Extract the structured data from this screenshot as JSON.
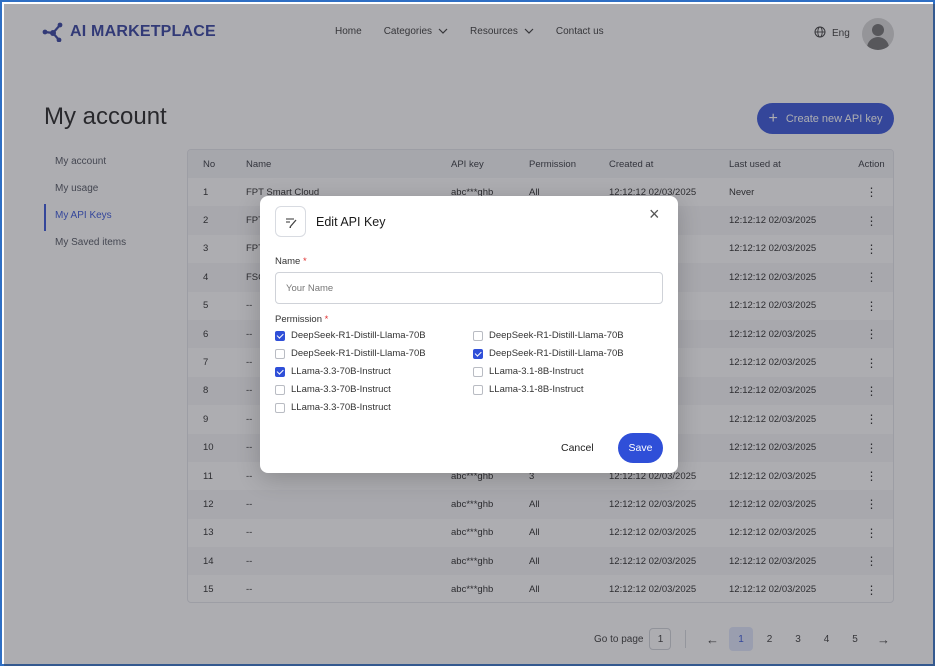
{
  "header": {
    "logo_text": "AI MARKETPLACE",
    "nav": [
      {
        "label": "Home",
        "dropdown": false
      },
      {
        "label": "Categories",
        "dropdown": true
      },
      {
        "label": "Resources",
        "dropdown": true
      },
      {
        "label": "Contact us",
        "dropdown": false
      }
    ],
    "language": "Eng"
  },
  "page": {
    "title": "My account",
    "create_button": "Create new API key"
  },
  "sidebar": {
    "items": [
      {
        "label": "My account",
        "active": false
      },
      {
        "label": "My usage",
        "active": false
      },
      {
        "label": "My API Keys",
        "active": true
      },
      {
        "label": "My Saved items",
        "active": false
      }
    ]
  },
  "table": {
    "columns": [
      "No",
      "Name",
      "API key",
      "Permission",
      "Created at",
      "Last used at",
      "Action"
    ],
    "rows": [
      {
        "no": "1",
        "name": "FPT Smart Cloud",
        "key": "abc***ghb",
        "perm": "All",
        "created": "12:12:12 02/03/2025",
        "last": "Never"
      },
      {
        "no": "2",
        "name": "FPT",
        "key": "",
        "perm": "",
        "created": "",
        "last": "12:12:12 02/03/2025"
      },
      {
        "no": "3",
        "name": "FPT",
        "key": "",
        "perm": "",
        "created": "",
        "last": "12:12:12 02/03/2025"
      },
      {
        "no": "4",
        "name": "FSC",
        "key": "",
        "perm": "",
        "created": "",
        "last": "12:12:12 02/03/2025"
      },
      {
        "no": "5",
        "name": "--",
        "key": "",
        "perm": "",
        "created": "",
        "last": "12:12:12 02/03/2025"
      },
      {
        "no": "6",
        "name": "--",
        "key": "",
        "perm": "",
        "created": "",
        "last": "12:12:12 02/03/2025"
      },
      {
        "no": "7",
        "name": "--",
        "key": "",
        "perm": "",
        "created": "",
        "last": "12:12:12 02/03/2025"
      },
      {
        "no": "8",
        "name": "--",
        "key": "",
        "perm": "",
        "created": "",
        "last": "12:12:12 02/03/2025"
      },
      {
        "no": "9",
        "name": "--",
        "key": "",
        "perm": "",
        "created": "",
        "last": "12:12:12 02/03/2025"
      },
      {
        "no": "10",
        "name": "--",
        "key": "",
        "perm": "",
        "created": "",
        "last": "12:12:12 02/03/2025"
      },
      {
        "no": "11",
        "name": "--",
        "key": "abc***ghb",
        "perm": "3",
        "created": "12:12:12 02/03/2025",
        "last": "12:12:12 02/03/2025"
      },
      {
        "no": "12",
        "name": "--",
        "key": "abc***ghb",
        "perm": "All",
        "created": "12:12:12 02/03/2025",
        "last": "12:12:12 02/03/2025"
      },
      {
        "no": "13",
        "name": "--",
        "key": "abc***ghb",
        "perm": "All",
        "created": "12:12:12 02/03/2025",
        "last": "12:12:12 02/03/2025"
      },
      {
        "no": "14",
        "name": "--",
        "key": "abc***ghb",
        "perm": "All",
        "created": "12:12:12 02/03/2025",
        "last": "12:12:12 02/03/2025"
      },
      {
        "no": "15",
        "name": "--",
        "key": "abc***ghb",
        "perm": "All",
        "created": "12:12:12 02/03/2025",
        "last": "12:12:12 02/03/2025"
      }
    ]
  },
  "pagination": {
    "goto_label": "Go to page",
    "goto_value": "1",
    "pages": [
      "1",
      "2",
      "3",
      "4",
      "5"
    ],
    "current": "1"
  },
  "modal": {
    "title": "Edit API Key",
    "name_label": "Name",
    "name_placeholder": "Your Name",
    "permission_label": "Permission",
    "required_mark": "*",
    "permissions": [
      {
        "label": "DeepSeek-R1-Distill-Llama-70B",
        "checked": true
      },
      {
        "label": "DeepSeek-R1-Distill-Llama-70B",
        "checked": false
      },
      {
        "label": "DeepSeek-R1-Distill-Llama-70B",
        "checked": false
      },
      {
        "label": "DeepSeek-R1-Distill-Llama-70B",
        "checked": true
      },
      {
        "label": "LLama-3.3-70B-Instruct",
        "checked": true
      },
      {
        "label": "LLama-3.1-8B-Instruct",
        "checked": false
      },
      {
        "label": "LLama-3.3-70B-Instruct",
        "checked": false
      },
      {
        "label": "LLama-3.1-8B-Instruct",
        "checked": false
      },
      {
        "label": "LLama-3.3-70B-Instruct",
        "checked": false
      }
    ],
    "cancel_label": "Cancel",
    "save_label": "Save"
  },
  "colors": {
    "accent": "#2f4fd8",
    "logo": "#2b3a9c",
    "frame_border": "#2f6fc4"
  }
}
